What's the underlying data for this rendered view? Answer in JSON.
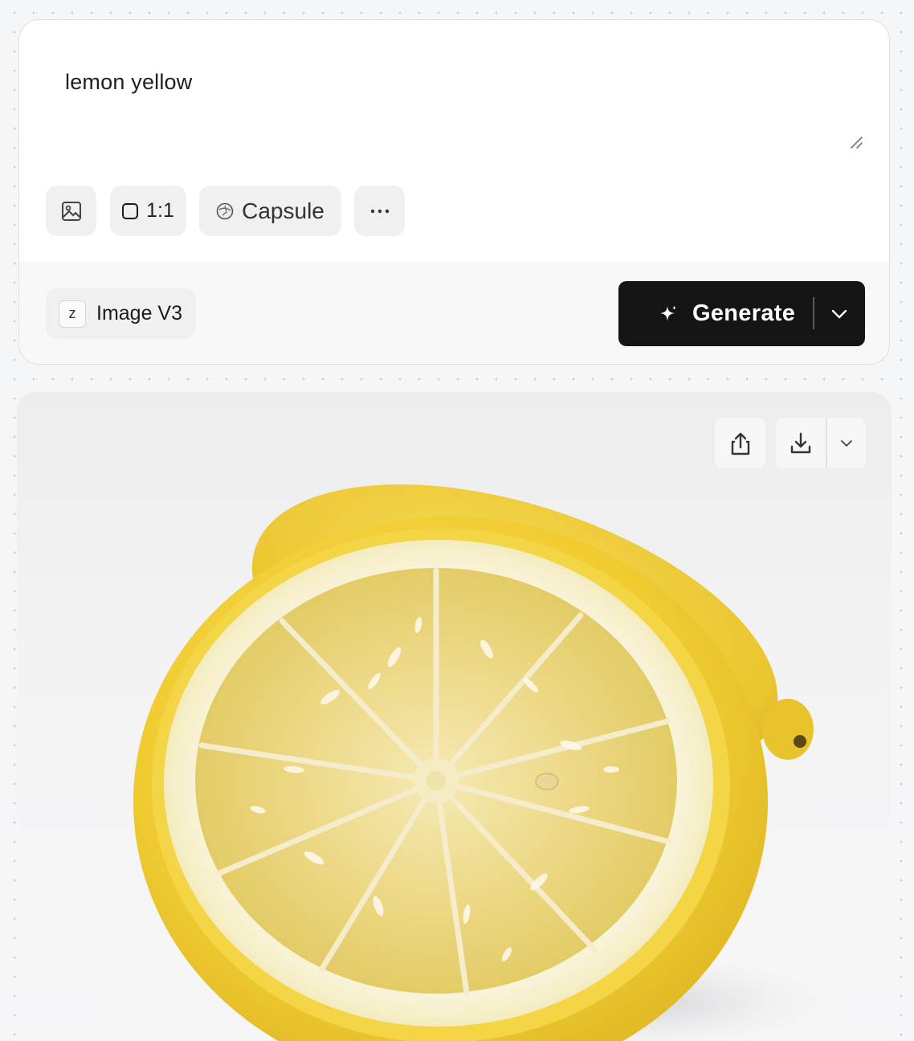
{
  "prompt": {
    "text": "lemon yellow"
  },
  "toolbar": {
    "image_icon": "image-icon",
    "aspect_ratio_label": "1:1",
    "style_label": "Capsule",
    "more_icon": "ellipsis-icon"
  },
  "footer": {
    "model_badge": "z",
    "model_label": "Image V3",
    "generate_label": "Generate"
  },
  "result": {
    "subject": "lemon image",
    "actions": [
      "share-icon",
      "download-icon",
      "chevron-down-icon"
    ]
  },
  "colors": {
    "page_bg": "#f5f6f8",
    "generate_bg": "#141414",
    "lemon_peel": "#f2d03b",
    "lemon_pulp": "#ecd884"
  }
}
